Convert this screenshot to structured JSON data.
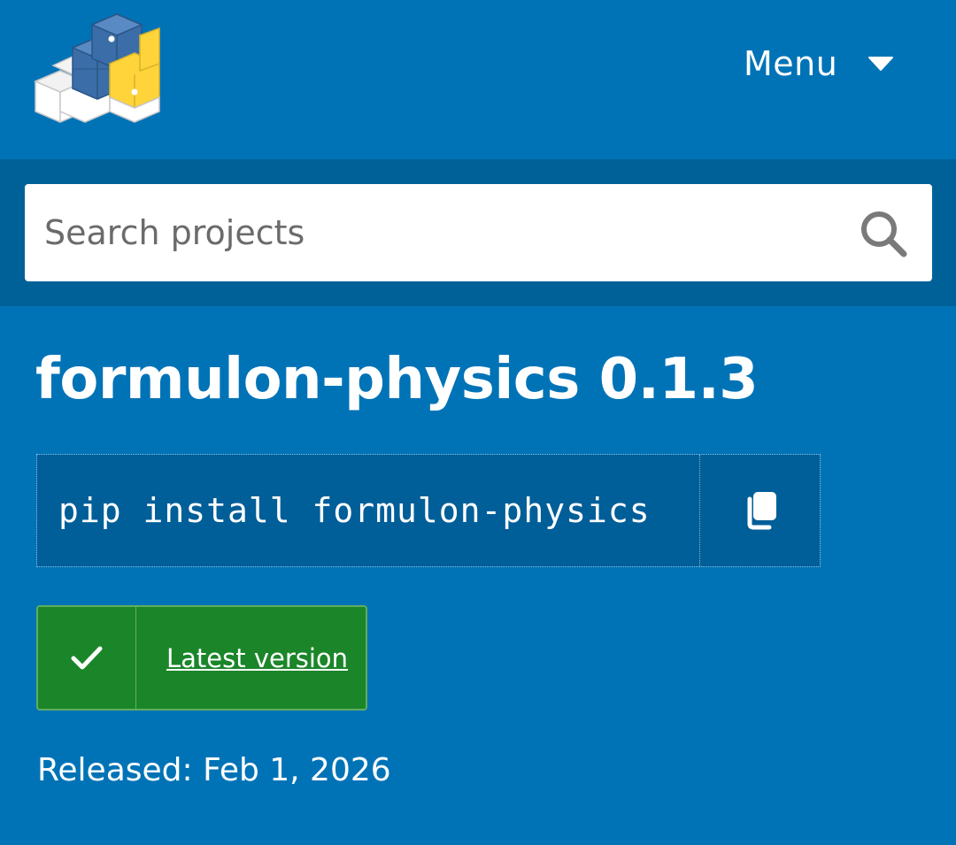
{
  "header": {
    "menu_label": "Menu"
  },
  "search": {
    "placeholder": "Search projects"
  },
  "project": {
    "title": "formulon-physics 0.1.3",
    "pip_command": "pip install formulon-physics",
    "latest_label": "Latest version",
    "released_text": "Released: Feb 1, 2026"
  },
  "icons": {
    "logo": "pypi-logo-icon",
    "menu_caret": "caret-down-icon",
    "search": "search-icon",
    "copy": "copy-icon",
    "check": "check-icon"
  },
  "colors": {
    "background": "#0073b7",
    "search_band": "#006199",
    "pip_background": "#005e98",
    "latest_badge": "#1a8629",
    "logo_blue": "#3b6ea8",
    "logo_yellow": "#ffd43b"
  }
}
